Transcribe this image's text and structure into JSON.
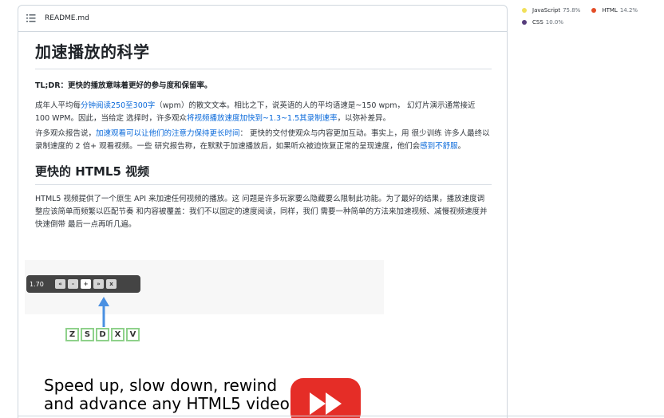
{
  "readme": {
    "filename": "README.md"
  },
  "article": {
    "title": "加速播放的科学",
    "tldr_label": "TL;DR：",
    "tldr_text": "更快的播放意味着更好的参与度和保留率。",
    "p1_a": "成年人平均每",
    "p1_link1": "分钟阅读250至300字",
    "p1_b": "（wpm）的散文文本。相比之下，说英语的人的平均语速是~150 wpm，  幻灯片演示通常接近 100 WPM。因此，当给定 选择时，许多观众",
    "p1_link2": "将视频播放速度加快到~1.3~1.5其录制速率",
    "p1_c": "，以弥补差异。",
    "p2_a": "许多观众报告说，",
    "p2_link1": "加速观看可以让他们的注意力保持更长时间",
    "p2_b": "：  更快的交付使观众与内容更加互动。事实上，用 很少训练 许多人最终以录制速度的 2 倍+ 观看视频。一些 研究报告称，在默默于加速播放后，如果听众被迫恢复正常的呈现速度，他们会",
    "p2_link2": "感到不舒服",
    "p2_c": "。",
    "h2": "更快的 HTML5 视频",
    "p3": "HTML5 视频提供了一个原生 API 来加速任何视频的播放。这 问题是许多玩家要么隐藏要么限制此功能。为了最好的结果，播放速度调整应该简单而频繁以匹配节奏 和内容被覆盖：我们不以固定的速度阅读，同样，我们 需要一种简单的方法来加速视频、减慢视频速度并快速倒带 最后一点再听几遍。"
  },
  "demo": {
    "speed": "1.70",
    "buttons": [
      "«",
      "-",
      "+",
      "»",
      "x"
    ],
    "keys": [
      "Z",
      "S",
      "D",
      "X",
      "V"
    ],
    "promo_line1": "Speed up, slow down, rewind",
    "promo_line2": "and advance any HTML5 video"
  },
  "languages": [
    {
      "name": "JavaScript",
      "percent": "75.8%",
      "color": "#f1e05a"
    },
    {
      "name": "HTML",
      "percent": "14.2%",
      "color": "#e34c26"
    },
    {
      "name": "CSS",
      "percent": "10.0%",
      "color": "#563d7c"
    }
  ]
}
